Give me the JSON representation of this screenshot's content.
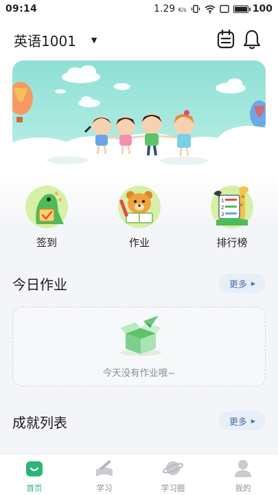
{
  "status_bar": {
    "time": "09:14",
    "speed": "1.29",
    "speed_unit": "K/s",
    "battery": "100"
  },
  "header": {
    "class_name": "英语1001",
    "calendar_icon": "calendar-icon",
    "bell_icon": "bell-icon"
  },
  "banner": {
    "illustration": "children-holding-hands-cloud-banner"
  },
  "quick_entries": [
    {
      "label": "签到",
      "icon": "dinosaur-checkin-icon"
    },
    {
      "label": "作业",
      "icon": "bear-homework-icon"
    },
    {
      "label": "排行榜",
      "icon": "giraffe-ranking-icon"
    }
  ],
  "today_homework": {
    "title": "今日作业",
    "more": "更多",
    "empty_text": "今天没有作业哦~"
  },
  "achievements": {
    "title": "成就列表",
    "more": "更多"
  },
  "tabbar": [
    {
      "label": "首页",
      "icon": "home-icon",
      "active": true
    },
    {
      "label": "学习",
      "icon": "book-pen-icon",
      "active": false
    },
    {
      "label": "学习圈",
      "icon": "planet-icon",
      "active": false
    },
    {
      "label": "我的",
      "icon": "profile-icon",
      "active": false
    }
  ],
  "colors": {
    "accent": "#2bb673",
    "more_bg": "#e8eef8",
    "more_text": "#4a6ea8",
    "banner_sky": "#8ee0d6"
  }
}
